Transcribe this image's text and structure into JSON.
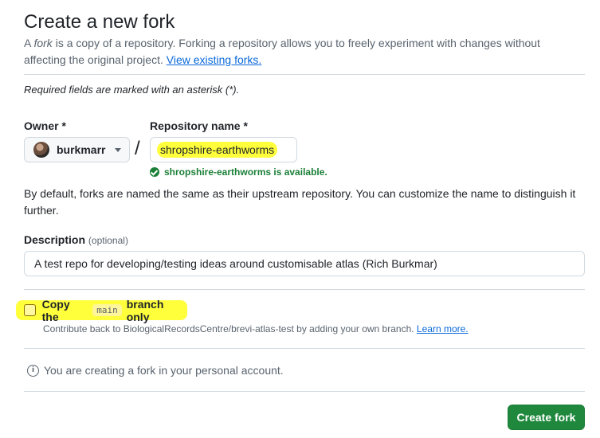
{
  "page": {
    "title": "Create a new fork",
    "intro_prefix": "A ",
    "intro_fork_word": "fork",
    "intro_text": " is a copy of a repository. Forking a repository allows you to freely experiment with changes without affecting the original project. ",
    "intro_link": "View existing forks.",
    "required_note": "Required fields are marked with an asterisk (*)."
  },
  "owner": {
    "label": "Owner *",
    "value": "burkmarr"
  },
  "slash": "/",
  "repo_name": {
    "label": "Repository name *",
    "value": "shropshire-earthworms",
    "availability": "shropshire-earthworms is available."
  },
  "default_note": "By default, forks are named the same as their upstream repository. You can customize the name to distinguish it further.",
  "description": {
    "label": "Description",
    "optional": "(optional)",
    "value": "A test repo for developing/testing ideas around customisable atlas (Rich Burkmar)"
  },
  "copy_branch": {
    "label_before": "Copy the",
    "branch": "main",
    "label_after": "branch only",
    "checked": false,
    "help_text": "Contribute back to BiologicalRecordsCentre/brevi-atlas-test by adding your own branch.",
    "help_link": "Learn more."
  },
  "info": {
    "text": "You are creating a fork in your personal account."
  },
  "actions": {
    "create_label": "Create fork"
  },
  "colors": {
    "primary_button": "#1f883d",
    "link": "#0969da",
    "success": "#1a7f37",
    "highlight": "#ffff3c"
  }
}
